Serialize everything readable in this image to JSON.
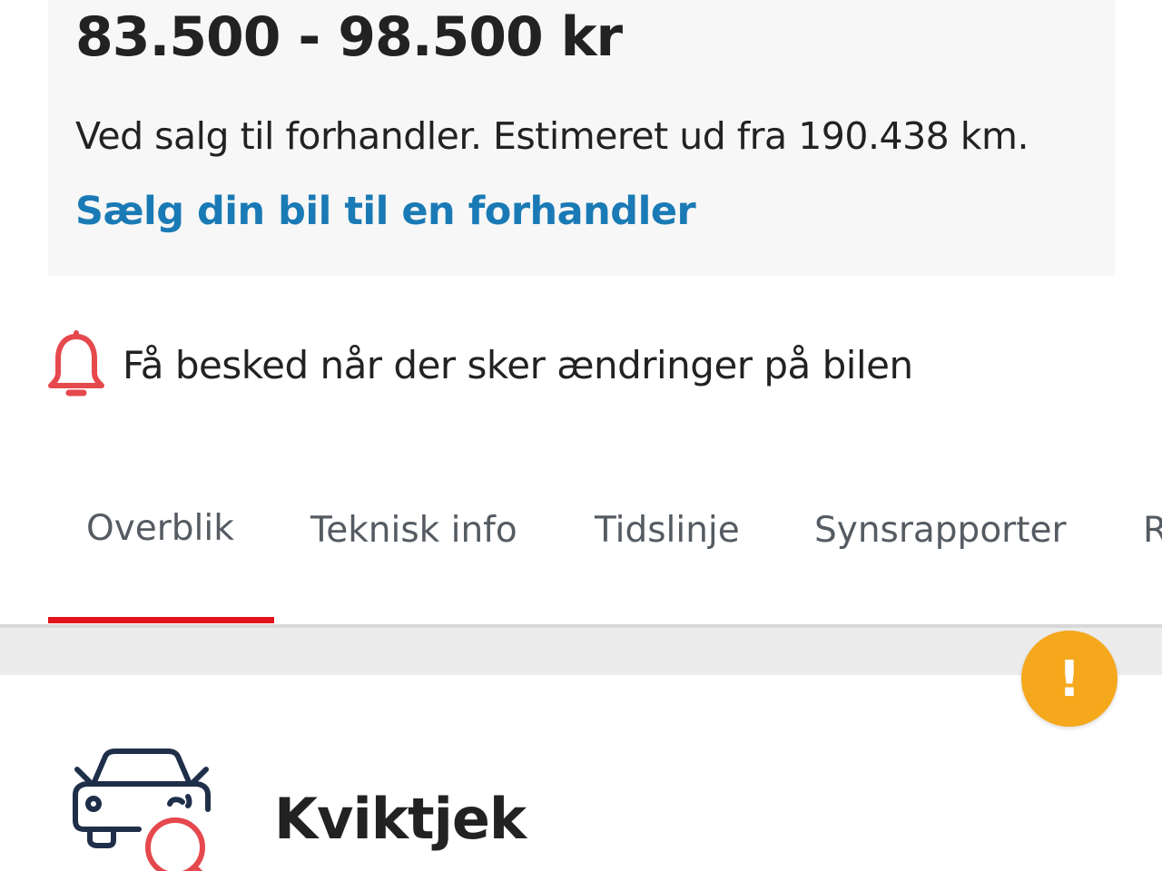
{
  "price": {
    "range": "83.500 - 98.500 kr",
    "note": "Ved salg til forhandler. Estimeret ud fra 190.438 km.",
    "link": "Sælg din bil til en forhandler"
  },
  "notify": {
    "icon": "bell-icon",
    "text": "Få besked når der sker ændringer på bilen"
  },
  "tabs": {
    "active": "Overblik",
    "items": [
      {
        "label": "Overblik"
      },
      {
        "label": "Teknisk info"
      },
      {
        "label": "Tidslinje"
      },
      {
        "label": "Synsrapporter"
      },
      {
        "label": "R"
      }
    ]
  },
  "alert_button": {
    "icon": "exclamation-icon",
    "symbol": "!"
  },
  "quick_check": {
    "icon": "car-search-icon",
    "title": "Kviktjek"
  },
  "colors": {
    "link": "#1a7ab5",
    "accent_red": "#e0121b",
    "bell_red": "#e5484d",
    "alert_yellow": "#f5a81c",
    "car_icon_navy": "#1f2f4a",
    "card_background": "#f7f7f7"
  }
}
